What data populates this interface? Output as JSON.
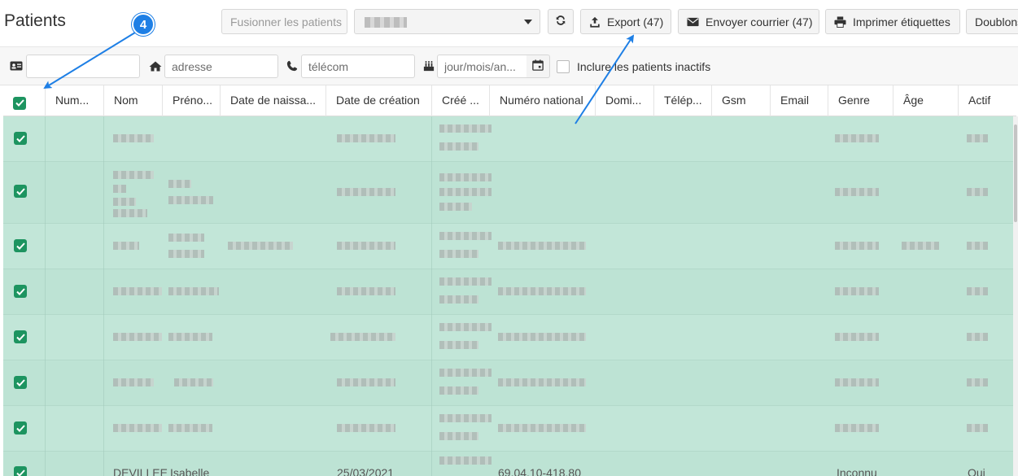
{
  "page": {
    "title": "Patients"
  },
  "toolbar": {
    "merge_label": "Fusionner les patients",
    "refresh_icon": "refresh-icon",
    "export_label": "Export (47)",
    "send_mail_label": "Envoyer courrier (47)",
    "print_labels_label": "Imprimer étiquettes",
    "duplicates_label": "Doublons"
  },
  "filters": {
    "id_placeholder": "",
    "address_placeholder": "adresse",
    "telecom_placeholder": "télécom",
    "birthdate_placeholder": "jour/mois/an...",
    "include_inactive_label": "Inclure les patients inactifs"
  },
  "table": {
    "columns": [
      "Num...",
      "Nom",
      "Préno...",
      "Date de naissa...",
      "Date de création",
      "Créé ...",
      "Numéro national",
      "Domi...",
      "Télép...",
      "Gsm",
      "Email",
      "Genre",
      "Âge",
      "Actif"
    ],
    "last_row": {
      "nom": "DEVILLEE",
      "prenom": "Isabelle",
      "date_creation": "25/03/2021",
      "numero_national": "69.04.10-418.80",
      "genre": "Inconnu",
      "actif": "Oui"
    }
  },
  "annotation": {
    "step_number": "4"
  },
  "colors": {
    "selected_row": "#c2e6d8",
    "checkbox_green": "#1d9460",
    "annotation_blue": "#1e7fe5"
  }
}
